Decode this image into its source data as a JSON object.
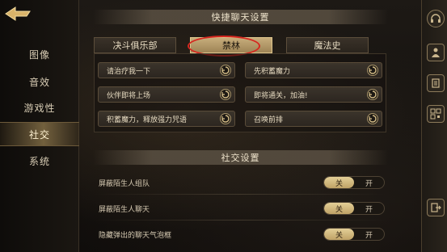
{
  "sidebar": {
    "items": [
      {
        "label": "图像"
      },
      {
        "label": "音效"
      },
      {
        "label": "游戏性"
      },
      {
        "label": "社交"
      },
      {
        "label": "系统"
      }
    ]
  },
  "quick_chat": {
    "title": "快捷聊天设置",
    "tabs": [
      {
        "label": "决斗俱乐部"
      },
      {
        "label": "禁林"
      },
      {
        "label": "魔法史"
      }
    ],
    "selected_tab": "禁林",
    "phrases": [
      {
        "text": "请治疗我一下"
      },
      {
        "text": "先积蓄魔力"
      },
      {
        "text": "伙伴即将上场"
      },
      {
        "text": "即将通关，加油!"
      },
      {
        "text": "积蓄魔力，释放强力咒语"
      },
      {
        "text": "召唤前排"
      }
    ]
  },
  "social": {
    "title": "社交设置",
    "rows": [
      {
        "label": "屏蔽陌生人组队",
        "off": "关",
        "on": "开",
        "value": "关"
      },
      {
        "label": "屏蔽陌生人聊天",
        "off": "关",
        "on": "开",
        "value": "关"
      },
      {
        "label": "隐藏弹出的聊天气泡框",
        "off": "关",
        "on": "开",
        "value": "关"
      }
    ]
  },
  "colors": {
    "accent_gold": "#c7ad7b",
    "annotation_red": "#d6261f"
  },
  "icons": [
    "back-arrow-icon",
    "headset-icon",
    "character-icon",
    "scroll-icon",
    "qr-code-icon",
    "exit-icon"
  ]
}
